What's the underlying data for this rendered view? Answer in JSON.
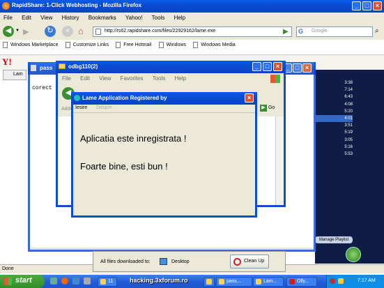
{
  "firefox": {
    "title": "RapidShare: 1-Click Webhosting - Mozilla Firefox",
    "menu": [
      "File",
      "Edit",
      "View",
      "History",
      "Bookmarks",
      "Yahoo!",
      "Tools",
      "Help"
    ],
    "url": "http://rs62.rapidshare.com/files/22929162/lame.exe",
    "search_placeholder": "Google",
    "bookmarks": [
      "Windows Marketplace",
      "Customize Links",
      "Free Hotmail",
      "Windows",
      "Windows Media"
    ],
    "status": "Done"
  },
  "yahoo": {
    "logo": "Y!",
    "tab": "Lam"
  },
  "pass_window": {
    "title": "pass",
    "text": "corect"
  },
  "odbg_window": {
    "title": "odbg110(2)",
    "menu": [
      "File",
      "Edit",
      "View",
      "Favorites",
      "Tools",
      "Help"
    ],
    "address_label": "Addr",
    "go_label": "Go"
  },
  "dialog": {
    "title": "Lame Application Registered by",
    "menu": [
      "Iesire",
      "Despre"
    ],
    "line1": "Aplicatia este inregistrata !",
    "line2": "Foarte bine, esti bun !"
  },
  "player": {
    "times": [
      "3:38",
      "7:14",
      "6:43",
      "4:08",
      "5:20",
      "4:01",
      "3:51",
      "5:19",
      "3:05",
      "5:16",
      "5:53"
    ],
    "manage_playlist": "Manage Playlist"
  },
  "download_bar": {
    "label": "All files downloaded to:",
    "folder": "Desktop",
    "cleanup": "Clean Up"
  },
  "taskbar": {
    "start": "start",
    "items": [
      "11",
      "",
      "pass...",
      "Lam...",
      "Olly..."
    ],
    "watermark": "hacking.3xforum.ro",
    "clock": "7:17 AM"
  },
  "colors": {
    "xp_blue": "#0b4dd3",
    "dialog_bg": "#ece9d8",
    "green": "#3a8f2e",
    "close_red": "#d9532c",
    "selected_row": "#316ac5"
  }
}
